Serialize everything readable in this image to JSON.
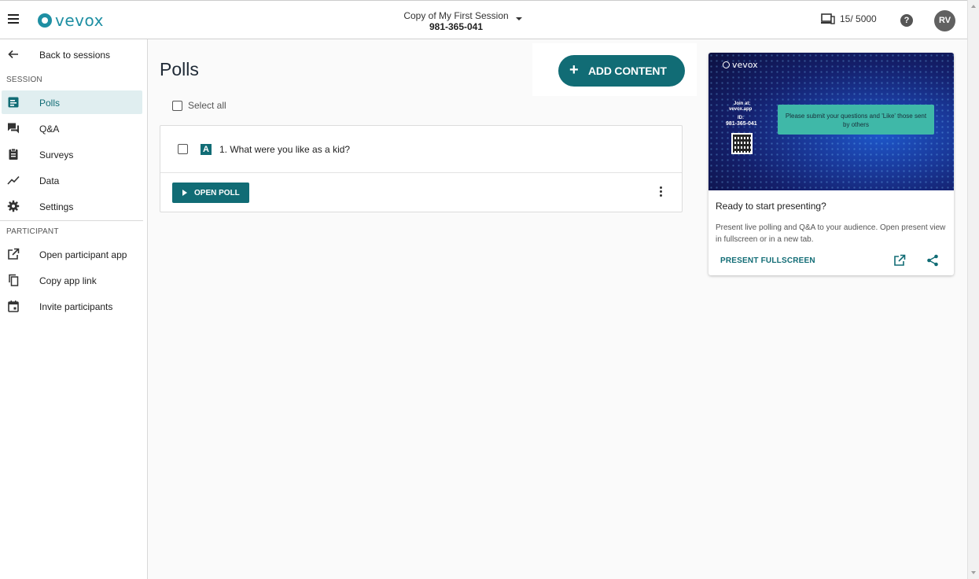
{
  "header": {
    "app_name": "vevox",
    "session_title": "Copy of My First Session",
    "session_code": "981-365-041",
    "participant_count": "15/ 5000",
    "help_glyph": "?",
    "avatar_initials": "RV"
  },
  "sidebar": {
    "back_label": "Back to sessions",
    "session_section": "SESSION",
    "session_items": [
      {
        "label": "Polls",
        "icon": "polls-icon",
        "active": true
      },
      {
        "label": "Q&A",
        "icon": "qa-icon",
        "active": false
      },
      {
        "label": "Surveys",
        "icon": "surveys-icon",
        "active": false
      },
      {
        "label": "Data",
        "icon": "data-icon",
        "active": false
      },
      {
        "label": "Settings",
        "icon": "gear-icon",
        "active": false
      }
    ],
    "participant_section": "PARTICIPANT",
    "participant_items": [
      {
        "label": "Open participant app",
        "icon": "open-in-new-icon"
      },
      {
        "label": "Copy app link",
        "icon": "copy-icon"
      },
      {
        "label": "Invite participants",
        "icon": "calendar-icon"
      }
    ]
  },
  "main": {
    "title": "Polls",
    "add_content_label": "ADD CONTENT",
    "add_content_glyph": "+",
    "select_all_label": "Select all",
    "polls": [
      {
        "type_badge": "A",
        "question": "1. What were you like as a kid?",
        "open_label": "OPEN POLL"
      }
    ]
  },
  "present_card": {
    "preview": {
      "logo_text": "vevox",
      "join_at": "Join at:",
      "join_url": "vevox.app",
      "id_label": "ID:",
      "id_value": "981-365-041",
      "bubble_text": "Please submit your questions and 'Like' those sent by others"
    },
    "heading": "Ready to start presenting?",
    "description": "Present live polling and Q&A to your audience. Open present view in fullscreen or in a new tab.",
    "fullscreen_label": "PRESENT FULLSCREEN"
  },
  "colors": {
    "accent": "#116c75",
    "brand": "#1e8fa3",
    "active_nav_bg": "#e0eef0",
    "bubble": "#3fb8a8"
  }
}
